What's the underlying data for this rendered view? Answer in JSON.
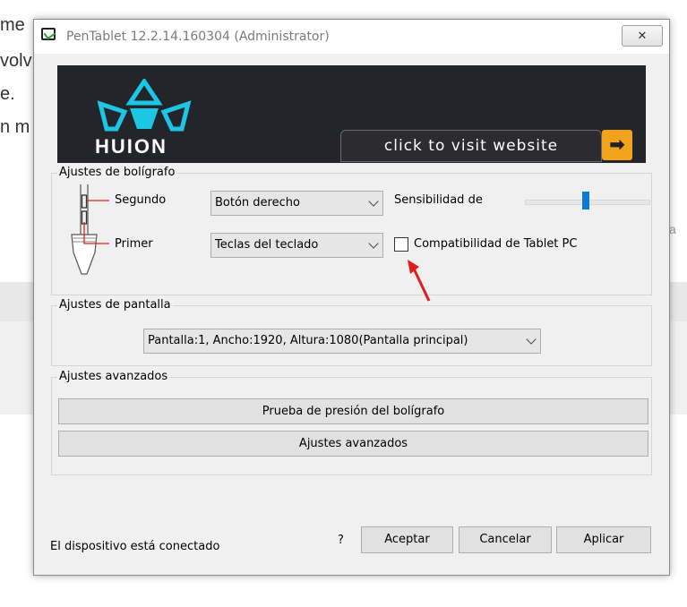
{
  "background": {
    "lines": [
      "me",
      "volv",
      "e.",
      "n m"
    ],
    "side_text": "a"
  },
  "window": {
    "title": "PenTablet 12.2.14.160304 (Administrator)",
    "close_label": "✕"
  },
  "banner": {
    "logo_text": "HUION",
    "visit_label": "click to visit website",
    "arrow": "➡"
  },
  "pen_settings": {
    "group_label": "Ajustes de bolígrafo",
    "second_label": "Segundo",
    "first_label": "Primer",
    "second_value": "Botón derecho",
    "first_value": "Teclas del teclado",
    "sensitivity_label": "Sensibilidad de",
    "sensitivity_level": 0.5,
    "tablet_pc_label": "Compatibilidad de Tablet PC",
    "tablet_pc_checked": false
  },
  "screen_settings": {
    "group_label": "Ajustes de pantalla",
    "value": "Pantalla:1, Ancho:1920, Altura:1080(Pantalla principal)"
  },
  "advanced": {
    "group_label": "Ajustes avanzados",
    "pressure_test_label": "Prueba de presión del bolígrafo",
    "advanced_button_label": "Ajustes avanzados"
  },
  "footer": {
    "status": "El dispositivo está conectado",
    "help": "?",
    "ok_label": "Aceptar",
    "cancel_label": "Cancelar",
    "apply_label": "Aplicar"
  },
  "colors": {
    "accent": "#0a7ad6",
    "annotation_arrow": "#e01e1e",
    "pen_lines": "#e01e1e",
    "banner_bg": "#23252a",
    "logo_cyan": "#1ec6e6",
    "arrow_button": "#f3a21c"
  }
}
